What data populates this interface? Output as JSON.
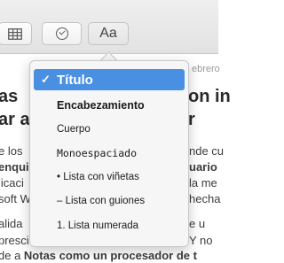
{
  "toolbar": {
    "format_button_label": "Aa"
  },
  "document": {
    "date_fragment": "ebrero",
    "title_line_1": "as",
    "title_line_1_right": "on in",
    "title_line_2": "ar a",
    "title_line_2_right": "r",
    "body_lines": [
      {
        "left": "e los",
        "right": "nde cu"
      },
      {
        "left": "enqui",
        "right": "uario"
      },
      {
        "left": "licaci",
        "right": "la me"
      },
      {
        "left": "soft W",
        "right": "hecha"
      },
      {
        "left": "alida",
        "right": "e u"
      },
      {
        "left": "presci",
        "right": "Y no"
      }
    ],
    "bottom_line_prefix": "de a ",
    "bottom_line_bold": "Notas como un procesador de t"
  },
  "format_menu": {
    "selected_check": "✓",
    "items": [
      {
        "label": "Título"
      },
      {
        "label": "Encabezamiento"
      },
      {
        "label": "Cuerpo"
      },
      {
        "label": "Monoespaciado"
      },
      {
        "label": "• Lista con viñetas"
      },
      {
        "label": "– Lista con guiones"
      },
      {
        "label": "1. Lista numerada"
      }
    ]
  },
  "colors": {
    "selection": "#4a90e2",
    "toolbar": "#e8e8e8"
  }
}
